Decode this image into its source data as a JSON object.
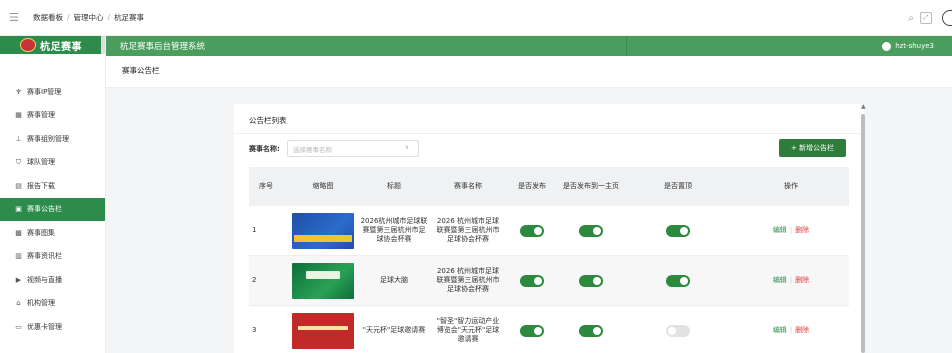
{
  "breadcrumb": [
    "数据看板",
    "管理中心",
    "杭足赛事"
  ],
  "sidebar": {
    "logo_text": "杭足赛事",
    "items": [
      {
        "label": "赛事IP管理",
        "icon": "trophy-icon",
        "active": false
      },
      {
        "label": "赛事管理",
        "icon": "board-icon",
        "active": false
      },
      {
        "label": "赛事组别管理",
        "icon": "org-chart-icon",
        "active": false
      },
      {
        "label": "球队管理",
        "icon": "shield-icon",
        "active": false
      },
      {
        "label": "报告下载",
        "icon": "report-icon",
        "active": false
      },
      {
        "label": "赛事公告栏",
        "icon": "bulletin-icon",
        "active": true
      },
      {
        "label": "赛事图集",
        "icon": "image-icon",
        "active": false
      },
      {
        "label": "赛事资讯栏",
        "icon": "news-icon",
        "active": false
      },
      {
        "label": "视频与直播",
        "icon": "video-icon",
        "active": false
      },
      {
        "label": "机构管理",
        "icon": "institution-icon",
        "active": false
      },
      {
        "label": "优惠卡管理",
        "icon": "card-icon",
        "active": false
      }
    ]
  },
  "header": {
    "system_title": "杭足赛事后台管理系统",
    "username": "hzt-shuye3"
  },
  "page": {
    "title": "赛事公告栏"
  },
  "card": {
    "title": "公告栏列表",
    "filter_label": "赛事名称:",
    "filter_placeholder": "选择赛事名称",
    "add_button": "+ 新增公告栏"
  },
  "table": {
    "columns": [
      "序号",
      "缩略图",
      "标题",
      "赛事名称",
      "是否发布",
      "是否发布到一主页",
      "是否置顶",
      "操作"
    ],
    "rows": [
      {
        "num": "1",
        "title": "2026杭州城市足球联赛暨第三届杭州市足球协会杯赛",
        "event": "2026 杭州城市足球联赛暨第三届杭州市足球协会杯赛",
        "published": true,
        "homepage": true,
        "pinned": true,
        "edit": "编辑",
        "delete": "删除"
      },
      {
        "num": "2",
        "title": "足球大脑",
        "event": "2026 杭州城市足球联赛暨第三届杭州市足球协会杯赛",
        "published": true,
        "homepage": true,
        "pinned": true,
        "edit": "编辑",
        "delete": "删除"
      },
      {
        "num": "3",
        "title": "\"天元杯\"足球邀请赛",
        "event": "\"智圣\"智力运动产业博览会\"天元杯\"足球邀请赛",
        "published": true,
        "homepage": true,
        "pinned": false,
        "edit": "编辑",
        "delete": "删除"
      }
    ]
  },
  "colors": {
    "brand_green": "#2d8c4b",
    "header_green": "#4a9d5d",
    "danger_red": "#e03b3b"
  }
}
